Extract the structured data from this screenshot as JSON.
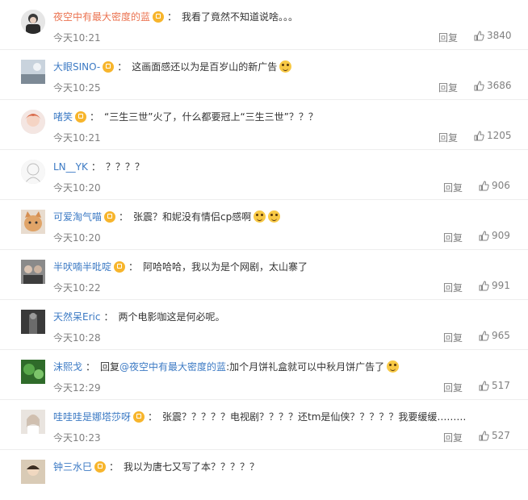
{
  "reply_label": "回复",
  "comments": [
    {
      "user": "夜空中有最大密度的蓝",
      "content": "我看了竟然不知道说啥。。。",
      "time": "今天10:21",
      "likes": "3840"
    },
    {
      "user": "大眼SINO-",
      "content": "这画面感还以为是百岁山的新广告",
      "time": "今天10:25",
      "likes": "3686"
    },
    {
      "user": "啫笑",
      "content": "“三生三世”火了，什么都要冠上“三生三世”？？？",
      "time": "今天10:21",
      "likes": "1205"
    },
    {
      "user": "LN__YK",
      "content": "？？？？",
      "time": "今天10:20",
      "likes": "906"
    },
    {
      "user": "可爱淘气喵",
      "content": "张震？和妮没有情侣cp感啊",
      "time": "今天10:20",
      "likes": "909"
    },
    {
      "user": "半吠喃半吡啶",
      "content": "阿哈哈哈，我以为是个网剧，太山寨了",
      "time": "今天10:22",
      "likes": "991"
    },
    {
      "user": "天然呆Eric",
      "content": "两个电影咖这是何必呢。",
      "time": "今天10:28",
      "likes": "965"
    },
    {
      "user": "沫熙戈",
      "reply_prefix": "回复",
      "mention": "@夜空中有最大密度的蓝",
      "content": ":加个月饼礼盒就可以中秋月饼广告了",
      "time": "今天12:29",
      "likes": "517"
    },
    {
      "user": "哇哇哇是娜塔莎呀",
      "content": "张震？？？？？电视剧？？？？还tm是仙侠？？？？？我要缓缓………",
      "time": "今天10:23",
      "likes": "527"
    },
    {
      "user": "钟三水巳",
      "content": "我以为唐七又写了本？？？？？",
      "time": "",
      "likes": ""
    }
  ]
}
